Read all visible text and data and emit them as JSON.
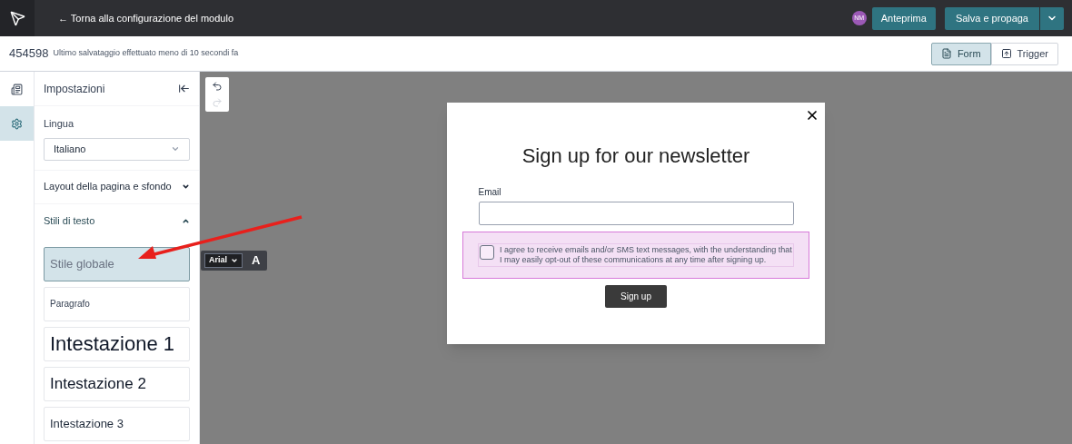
{
  "top_bar": {
    "back_link": "← Torna alla configurazione del modulo",
    "avatar": "NM",
    "preview_button": "Anteprima",
    "save_button": "Salva e propaga"
  },
  "sub_bar": {
    "form_id": "454598",
    "save_status": "Ultimo salvataggio effettuato meno di 10 secondi fa",
    "view_tabs": [
      {
        "label": "Form",
        "kind": "form",
        "selected": true
      },
      {
        "label": "Trigger",
        "kind": "trigger",
        "selected": false
      }
    ]
  },
  "rail": [
    {
      "kind": "form",
      "selected": false
    },
    {
      "kind": "settings",
      "selected": true
    }
  ],
  "panel": {
    "title": "Impostazioni",
    "language_label": "Lingua",
    "language_value": "Italiano",
    "sections": [
      {
        "label": "Layout della pagina e sfondo",
        "expanded": false
      },
      {
        "label": "Stili di testo",
        "expanded": true
      }
    ],
    "text_styles": [
      {
        "label": "Stile globale",
        "kind": "global",
        "selected": true
      },
      {
        "label": "Paragrafo",
        "kind": "paragraph",
        "selected": false
      },
      {
        "label": "Intestazione 1",
        "kind": "h1",
        "selected": false
      },
      {
        "label": "Intestazione 2",
        "kind": "h2",
        "selected": false
      },
      {
        "label": "Intestazione 3",
        "kind": "h3",
        "selected": false
      }
    ]
  },
  "history": [
    {
      "kind": "undo",
      "disabled": false
    },
    {
      "kind": "redo",
      "disabled": true
    }
  ],
  "font_toolbar": {
    "font": "Arial",
    "letter": "A"
  },
  "modal": {
    "title": "Sign up for our newsletter",
    "email_label": "Email",
    "consent": {
      "text": "I agree to receive emails and/or SMS text messages, with the understanding that I may easily opt-out of these communications at any time after signing up.",
      "checked": false,
      "highlighted": true
    },
    "submit": "Sign up"
  }
}
